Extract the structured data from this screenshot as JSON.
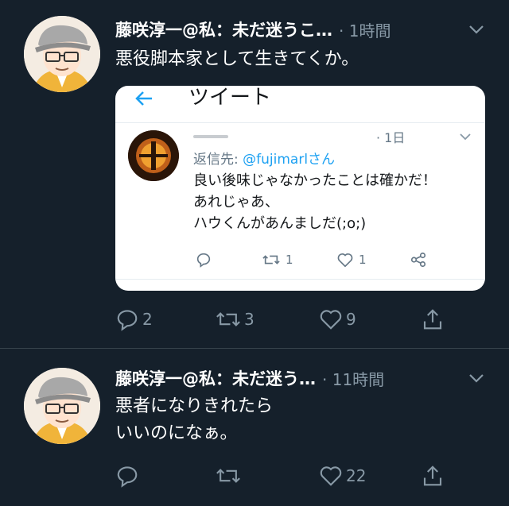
{
  "tweets": [
    {
      "display_name": "藤咲淳一@私：未だ迷うこ…",
      "time": "· 1時間",
      "text": "悪役脚本家として生きてくか。",
      "reply_count": "2",
      "retweet_count": "3",
      "like_count": "9",
      "embedded": {
        "title": "ツイート",
        "time": "· 1日",
        "reply_prefix": "返信先: ",
        "reply_handle": "@fujimarlさん",
        "lines": [
          "良い後味じゃなかったことは確かだ！",
          "あれじゃあ、",
          "ハウくんがあんましだ(;o;)"
        ],
        "retweet_count": "1",
        "like_count": "1"
      }
    },
    {
      "display_name": "藤咲淳一@私：未だ迷う…",
      "time": "· 11時間",
      "lines": [
        "悪者になりきれたら",
        "いいのになぁ。"
      ],
      "like_count": "22"
    }
  ],
  "colors": {
    "background": "#15202b",
    "secondary": "#8899a6",
    "accent": "#1da1f2"
  }
}
